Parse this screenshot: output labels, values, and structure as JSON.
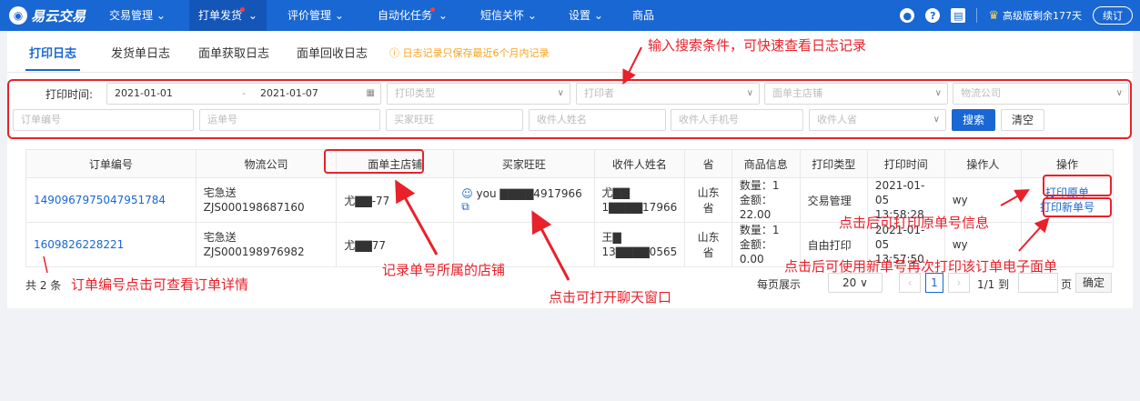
{
  "nav": {
    "logo": "易云交易",
    "items": [
      {
        "label": "交易管理",
        "caret": "⌄"
      },
      {
        "label": "打单发货",
        "caret": "⌄"
      },
      {
        "label": "评价管理",
        "caret": "⌄"
      },
      {
        "label": "自动化任务",
        "caret": "⌄"
      },
      {
        "label": "短信关怀",
        "caret": "⌄"
      },
      {
        "label": "设置",
        "caret": "⌄"
      },
      {
        "label": "商品",
        "caret": ""
      }
    ],
    "vip_text": "高级版剩余177天",
    "renew": "续订"
  },
  "tabs": [
    "打印日志",
    "发货单日志",
    "面单获取日志",
    "面单回收日志"
  ],
  "notice": "日志记录只保存最近6个月内记录",
  "filters": {
    "print_time_label": "打印时间:",
    "date_start": "2021-01-01",
    "date_sep": "-",
    "date_end": "2021-01-07",
    "print_type": "打印类型",
    "printer": "打印者",
    "shop": "面单主店铺",
    "logistics": "物流公司",
    "order_no": "订单编号",
    "waybill_no": "运单号",
    "buyer_ww": "买家旺旺",
    "receiver_name": "收件人姓名",
    "receiver_phone": "收件人手机号",
    "receiver_prov": "收件人省",
    "search": "搜索",
    "clear": "清空"
  },
  "table": {
    "headers": [
      "订单编号",
      "物流公司",
      "面单主店铺",
      "买家旺旺",
      "收件人姓名",
      "省",
      "商品信息",
      "打印类型",
      "打印时间",
      "操作人",
      "操作"
    ],
    "rows": [
      {
        "order_no": "1490967975047951784",
        "logistics_name": "宅急送",
        "logistics_no": "ZJS000198687160",
        "shop": "尤▇▇-77",
        "buyer": "you ▇▇▇▇4917966",
        "recv_name": "尤▇▇",
        "recv_phone": "1▇▇▇▇17966",
        "province": "山东省",
        "qty": "数量：1",
        "amount": "金额：22.00",
        "print_type": "交易管理",
        "time_date": "2021-01-05",
        "time_clock": "13:58:28",
        "operator": "wy",
        "op1": "打印原单",
        "op2": "打印新单号"
      },
      {
        "order_no": "1609826228221",
        "logistics_name": "宅急送",
        "logistics_no": "ZJS000198976982",
        "shop": "尤▇▇77",
        "buyer": "",
        "recv_name": "王▇",
        "recv_phone": "13▇▇▇▇0565",
        "province": "山东省",
        "qty": "数量：1",
        "amount": "金额：0.00",
        "print_type": "自由打印",
        "time_date": "2021-01-05",
        "time_clock": "13:57:50",
        "operator": "wy",
        "op1": "",
        "op2": ""
      }
    ]
  },
  "footer": {
    "total": "共 2 条",
    "page_size_label": "每页展示",
    "page_size": "20",
    "current_page": "1",
    "page_info": "1/1 到",
    "page_unit": "页",
    "confirm": "确定"
  },
  "annotations": {
    "search_hint": "输入搜索条件，可快速查看日志记录",
    "order_hint": "订单编号点击可查看订单详情",
    "shop_hint": "记录单号所属的店铺",
    "chat_hint": "点击可打开聊天窗口",
    "orig_hint": "点击后可打印原单号信息",
    "new_hint": "点击后可使用新单号再次打印该订单电子面单"
  },
  "colors": {
    "primary": "#1967d2",
    "annotation": "#e8212b",
    "notice": "#f6a31b"
  }
}
